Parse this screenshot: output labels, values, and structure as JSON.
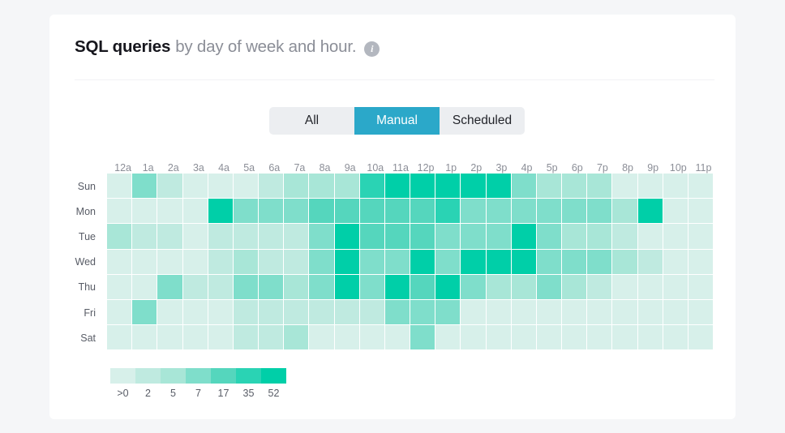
{
  "card": {
    "title_strong": "SQL queries",
    "title_rest": "by day of week and hour.",
    "info_icon_label": "i"
  },
  "tabs": [
    {
      "label": "All",
      "active": false
    },
    {
      "label": "Manual",
      "active": true
    },
    {
      "label": "Scheduled",
      "active": false
    }
  ],
  "colors": {
    "accent_tab": "#2ba8c9",
    "card_bg": "#ffffff",
    "page_bg": "#f5f6f8",
    "scale": [
      "#d7f0ea",
      "#bfeae0",
      "#a8e6d7",
      "#7fdecb",
      "#55d6bd",
      "#2ad3b4",
      "#00cfa8"
    ]
  },
  "chart_data": {
    "type": "heatmap",
    "title": "SQL queries by day of week and hour.",
    "xlabel": "",
    "ylabel": "",
    "legend_position": "bottom-left",
    "legend_title": "",
    "color_scale_labels": [
      ">0",
      "2",
      "5",
      "7",
      "17",
      "35",
      "52"
    ],
    "color_scale_colors": [
      "#d7f0ea",
      "#bfeae0",
      "#a8e6d7",
      "#7fdecb",
      "#55d6bd",
      "#2ad3b4",
      "#00cfa8"
    ],
    "x": [
      "12a",
      "1a",
      "2a",
      "3a",
      "4a",
      "5a",
      "6a",
      "7a",
      "8a",
      "9a",
      "10a",
      "11a",
      "12p",
      "1p",
      "2p",
      "3p",
      "4p",
      "5p",
      "6p",
      "7p",
      "8p",
      "9p",
      "10p",
      "11p"
    ],
    "y": [
      "Sun",
      "Mon",
      "Tue",
      "Wed",
      "Thu",
      "Fri",
      "Sat"
    ],
    "values": [
      [
        1,
        4,
        2,
        1,
        1,
        1,
        2,
        3,
        3,
        3,
        6,
        7,
        7,
        7,
        7,
        7,
        4,
        3,
        3,
        3,
        1,
        1,
        1,
        1
      ],
      [
        1,
        1,
        1,
        1,
        7,
        4,
        4,
        4,
        5,
        5,
        5,
        5,
        5,
        6,
        4,
        4,
        4,
        4,
        4,
        4,
        3,
        7,
        1,
        1
      ],
      [
        3,
        2,
        2,
        1,
        2,
        2,
        2,
        2,
        4,
        7,
        5,
        5,
        5,
        4,
        4,
        4,
        7,
        4,
        3,
        3,
        2,
        1,
        1,
        1
      ],
      [
        1,
        1,
        1,
        1,
        2,
        3,
        2,
        2,
        4,
        7,
        4,
        4,
        7,
        4,
        7,
        7,
        7,
        4,
        4,
        4,
        3,
        2,
        1,
        1
      ],
      [
        1,
        1,
        4,
        2,
        2,
        4,
        4,
        3,
        4,
        7,
        4,
        7,
        5,
        7,
        4,
        3,
        3,
        4,
        3,
        2,
        1,
        1,
        1,
        1
      ],
      [
        1,
        4,
        1,
        1,
        1,
        2,
        2,
        2,
        2,
        2,
        2,
        4,
        4,
        4,
        1,
        1,
        1,
        1,
        1,
        1,
        1,
        1,
        1,
        1
      ],
      [
        1,
        1,
        1,
        1,
        1,
        2,
        2,
        3,
        1,
        1,
        1,
        1,
        4,
        1,
        1,
        1,
        1,
        1,
        1,
        1,
        1,
        1,
        1,
        1
      ]
    ]
  }
}
